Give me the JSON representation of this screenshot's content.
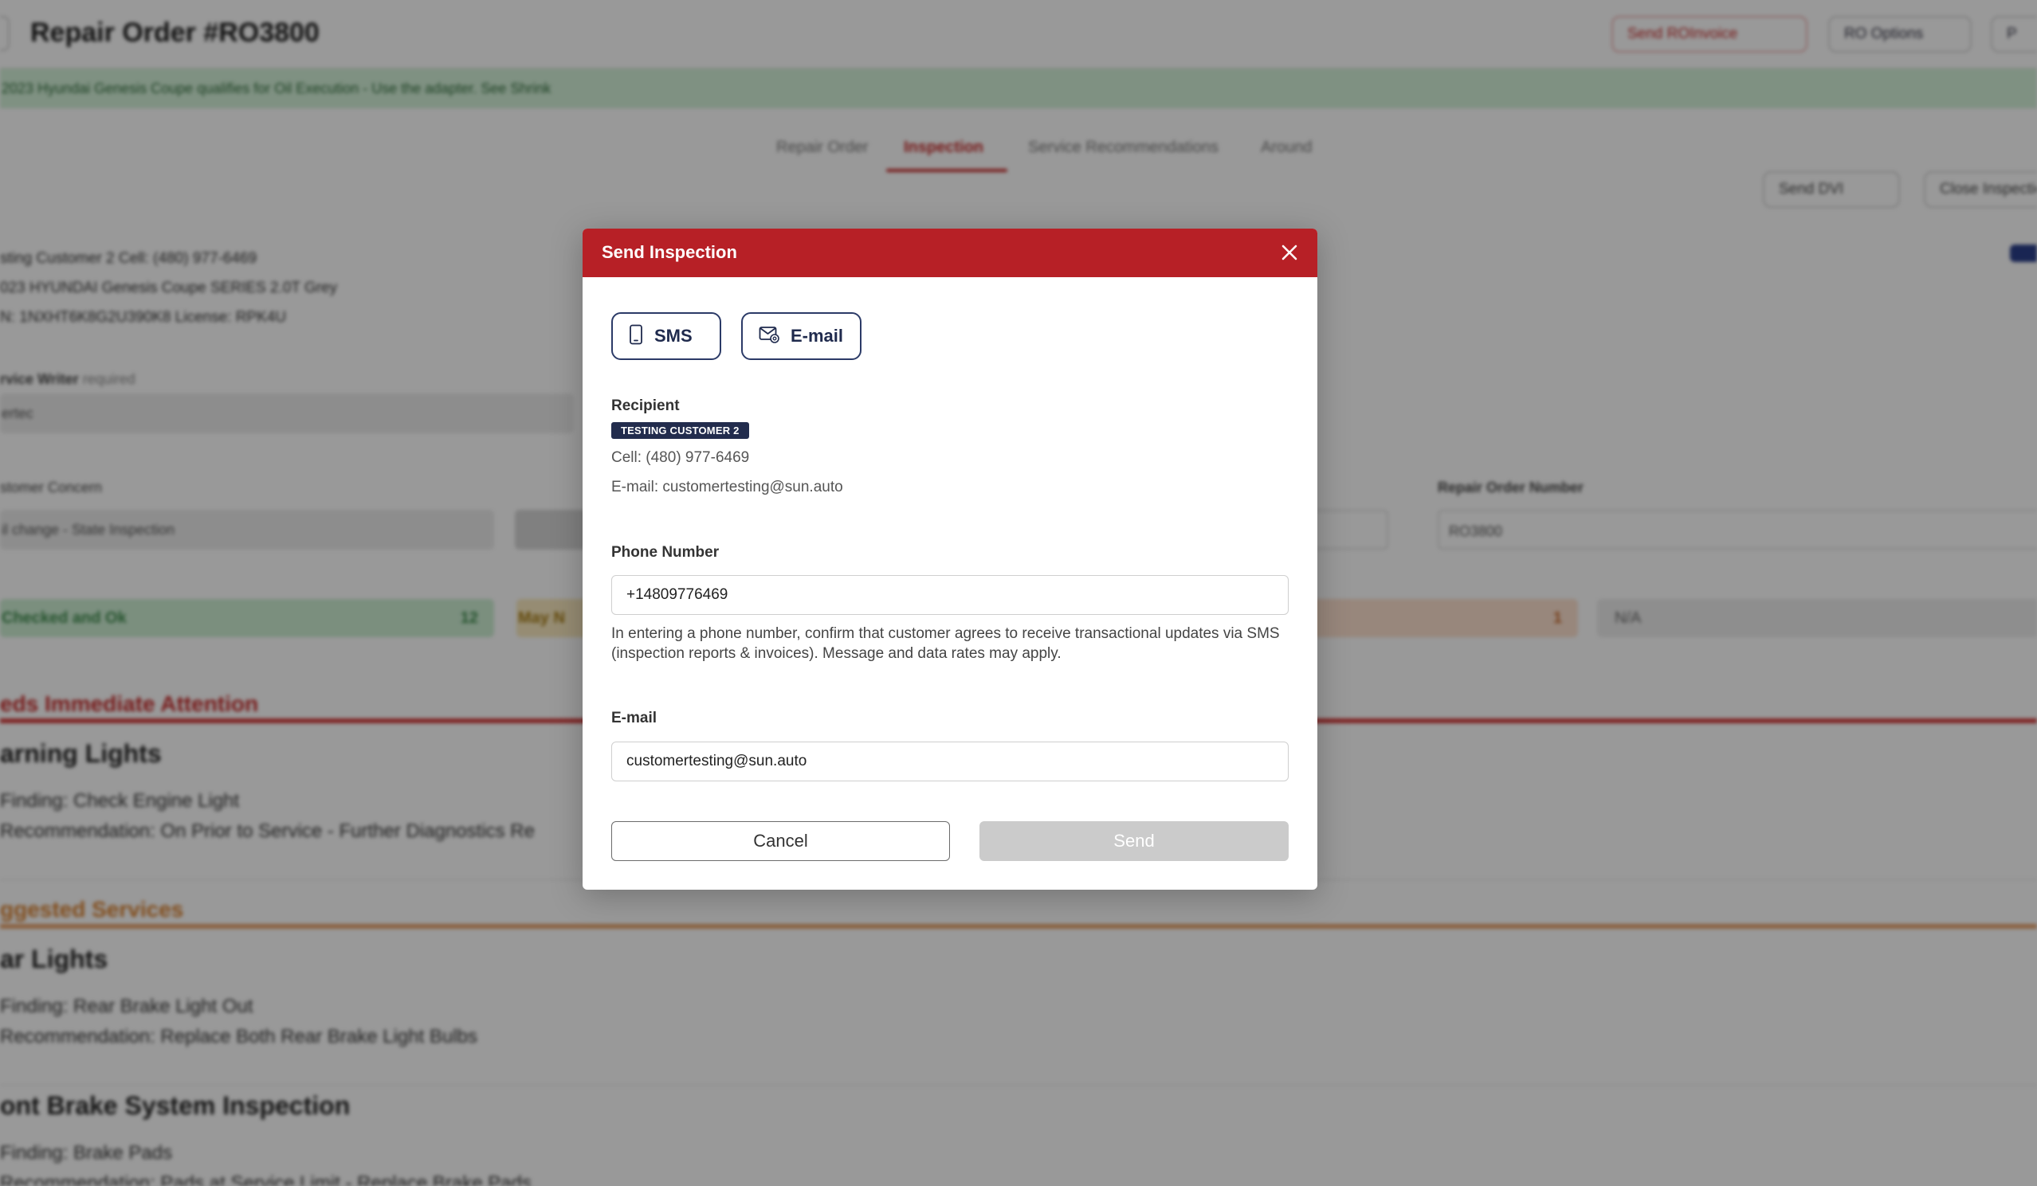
{
  "background": {
    "page_title": "Repair Order #RO3800",
    "top_actions": [
      "Send ROInvoice",
      "RO Options",
      "P"
    ],
    "promo_banner": "2023 Hyundai Genesis Coupe qualifies for Oil Execution - Use the adapter. See Shrink",
    "tabs": [
      "Repair Order",
      "Inspection",
      "Service Recommendations",
      "Around"
    ],
    "sub_actions": [
      "Send DVI",
      "Close Inspection"
    ],
    "customer": {
      "name_line": "sting Customer 2     Cell: (480) 977-6469",
      "vehicle_line": "023 HYUNDAI Genesis Coupe SERIES 2.0T Grey",
      "vin_line": "N: 1NXHT6K8G2U390K8     License: RPK4U"
    },
    "service_writer_label": "rvice Writer",
    "service_writer_required": "required",
    "service_writer_value": "ertec",
    "customer_concern_label": "stomer Concern",
    "customer_concern_value": "il change - State Inspection",
    "ro_number_label": "Repair Order Number",
    "ro_number_value": "RO3800",
    "status_green": "Checked and Ok",
    "status_green_count": "12",
    "status_yellow": "May N",
    "status_orange_count": "1",
    "status_gray": "N/A",
    "needs_attention_heading": "eds Immediate Attention",
    "warning_lights_title": "arning Lights",
    "warning_finding": "Finding: Check Engine Light",
    "warning_recommendation": "Recommendation: On Prior to Service - Further Diagnostics Re",
    "suggested_heading": "ggested Services",
    "rear_lights_title": "ar Lights",
    "rear_finding": "Finding: Rear Brake Light Out",
    "rear_recommendation": "Recommendation: Replace Both Rear Brake Light Bulbs",
    "brake_title": "ont Brake System Inspection",
    "brake_finding": "Finding: Brake Pads",
    "brake_recommendation": "Recommendation: Pads at Service Limit - Replace Brake Pads"
  },
  "modal": {
    "title": "Send Inspection",
    "channels": {
      "sms": "SMS",
      "email": "E-mail"
    },
    "recipient_label": "Recipient",
    "recipient_badge": "TESTING CUSTOMER 2",
    "cell_line": "Cell: (480) 977-6469",
    "email_line": "E-mail: customertesting@sun.auto",
    "phone_label": "Phone Number",
    "phone_value": "+14809776469",
    "phone_note": "In entering a phone number, confirm that customer agrees to receive transactional updates via SMS (inspection reports & invoices). Message and data rates may apply.",
    "email_label": "E-mail",
    "email_value": "customertesting@sun.auto",
    "cancel_label": "Cancel",
    "send_label": "Send"
  },
  "colors": {
    "header_red": "#b72026",
    "badge_navy": "#222c4d",
    "button_outline": "#2b3a67",
    "send_disabled": "#cbcbcb"
  }
}
